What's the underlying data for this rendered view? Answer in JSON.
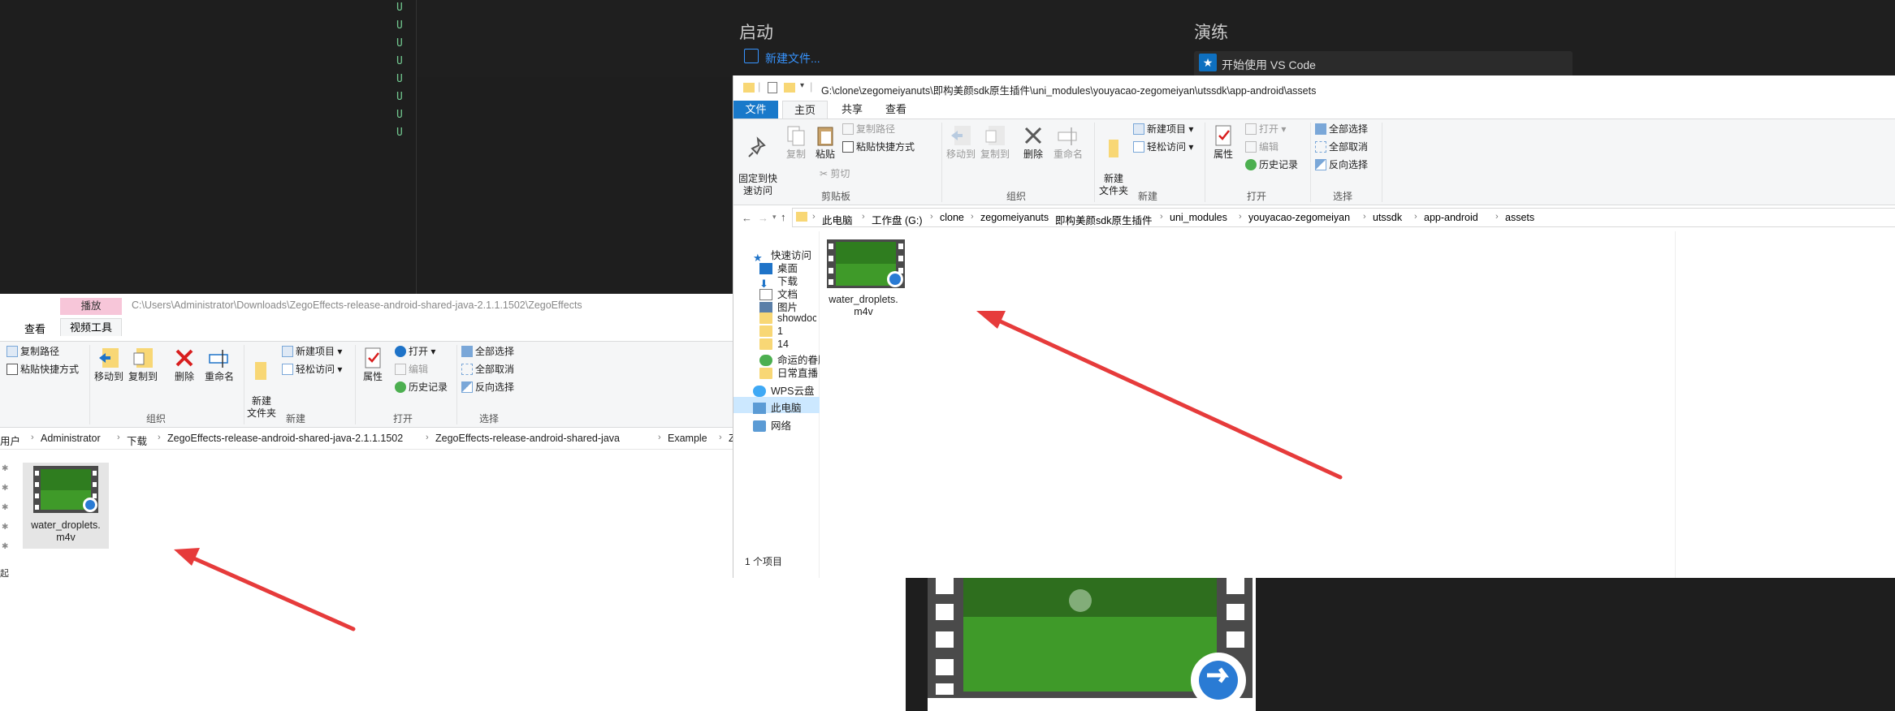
{
  "vscode": {
    "git_status": [
      "U",
      "U",
      "U",
      "U",
      "U",
      "U",
      "U",
      "U"
    ],
    "start_heading": "启动",
    "new_file_link": "新建文件...",
    "walkthrough_heading": "演练",
    "walkthrough_item": "开始使用 VS Code"
  },
  "explorer_left": {
    "contextual_tab_group": "播放",
    "address_title": "C:\\Users\\Administrator\\Downloads\\ZegoEffects-release-android-shared-java-2.1.1.1502\\ZegoEffects",
    "tabs": {
      "view": "查看",
      "video_tools": "视频工具"
    },
    "ribbon": {
      "copy_path": "复制路径",
      "paste_shortcut": "粘贴快捷方式",
      "move_to": "移动到",
      "copy_to": "复制到",
      "delete": "删除",
      "rename": "重命名",
      "new_folder": "新建\n文件夹",
      "new_item": "新建项目",
      "easy_access": "轻松访问",
      "properties": "属性",
      "open": "打开",
      "edit": "编辑",
      "history": "历史记录",
      "select_all": "全部选择",
      "select_none": "全部取消",
      "invert": "反向选择",
      "group_organize": "组织",
      "group_new": "新建",
      "group_open": "打开",
      "group_select": "选择"
    },
    "breadcrumbs": [
      "用户",
      "Administrator",
      "下载",
      "ZegoEffects-release-android-shared-java-2.1.1.1502",
      "ZegoEffects-release-android-shared-java",
      "Example",
      "ZegoE"
    ],
    "file_name": "water_droplets.\nm4v",
    "truncated_nav_text": "起"
  },
  "explorer_right": {
    "path_title": "G:\\clone\\zegomeiyanuts\\即构美颜sdk原生插件\\uni_modules\\youyacao-zegomeiyan\\utssdk\\app-android\\assets",
    "tabs": {
      "file": "文件",
      "home": "主页",
      "share": "共享",
      "view": "查看"
    },
    "ribbon": {
      "pin": "固定到快\n速访问",
      "copy": "复制",
      "paste": "粘贴",
      "copy_path": "复制路径",
      "paste_shortcut": "粘贴快捷方式",
      "cut": "剪切",
      "move_to": "移动到",
      "copy_to": "复制到",
      "delete": "删除",
      "rename": "重命名",
      "new_folder": "新建\n文件夹",
      "new_item": "新建项目",
      "easy_access": "轻松访问",
      "properties": "属性",
      "open": "打开",
      "edit": "编辑",
      "history": "历史记录",
      "select_all": "全部选择",
      "select_none": "全部取消",
      "invert": "反向选择",
      "group_clipboard": "剪贴板",
      "group_organize": "组织",
      "group_new": "新建",
      "group_open": "打开",
      "group_select": "选择"
    },
    "breadcrumbs": [
      "此电脑",
      "工作盘 (G:)",
      "clone",
      "zegomeiyanuts",
      "即构美颜sdk原生插件",
      "uni_modules",
      "youyacao-zegomeiyan",
      "utssdk",
      "app-android",
      "assets"
    ],
    "nav": {
      "quick_access": "快速访问",
      "desktop": "桌面",
      "downloads": "下载",
      "documents": "文档",
      "pictures": "图片",
      "showdoc": "showdoc-maste",
      "folder_1": "1",
      "folder_14": "14",
      "fate": "命运的眷顾：崛起之",
      "daily_live": "日常直播",
      "wps": "WPS云盘",
      "this_pc": "此电脑",
      "network": "网络"
    },
    "file_name": "water_droplets.\nm4v",
    "status": "1 个项目"
  },
  "colors": {
    "arrow": "#e63b3b",
    "file_tab": "#1979ca",
    "selected_nav": "#cce8ff",
    "selected_tile": "#e5e5e5",
    "play_tab": "#f7c6d9"
  }
}
